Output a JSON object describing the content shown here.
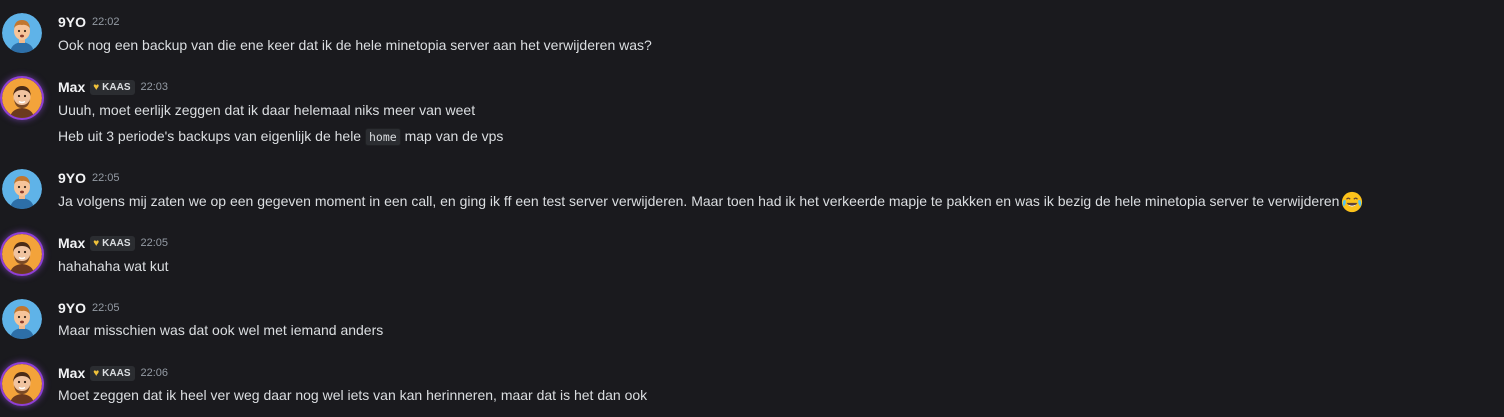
{
  "messages": [
    {
      "author": "9YO",
      "time": "22:02",
      "lines": [
        "Ook nog een backup van die ene keer dat ik de hele minetopia server aan het verwijderen was?"
      ]
    },
    {
      "author": "Max",
      "tag": "KAAS",
      "time": "22:03",
      "line1": "Uuuh, moet eerlijk zeggen dat ik daar helemaal niks meer van weet",
      "line2_before": "Heb uit 3 periode's backups van eigenlijk de hele",
      "line2_code": "home",
      "line2_after": "map van de vps"
    },
    {
      "author": "9YO",
      "time": "22:05",
      "lines": [
        "Ja volgens mij zaten we op een gegeven moment in een call, en ging ik ff een test server verwijderen. Maar toen had ik het verkeerde mapje te pakken en was ik bezig de hele minetopia server te verwijderen"
      ],
      "emoji": "joy-emoji"
    },
    {
      "author": "Max",
      "tag": "KAAS",
      "time": "22:05",
      "lines": [
        "hahahaha wat kut"
      ]
    },
    {
      "author": "9YO",
      "time": "22:05",
      "lines": [
        "Maar misschien was dat ook wel met iemand anders"
      ]
    },
    {
      "author": "Max",
      "tag": "KAAS",
      "time": "22:06",
      "lines": [
        "Moet zeggen dat ik heel ver weg daar nog wel iets van kan herinneren, maar dat is het dan ook"
      ]
    }
  ],
  "colors": {
    "background": "#1a1a1e",
    "text": "#dbdee1",
    "username": "#f2f3f5",
    "timestamp": "#949ba4",
    "avatar_ring": "#8f3fd6",
    "tag_heart": "#f0c23a"
  },
  "icons": {
    "avatar_9yo": "avatar-9yo-icon",
    "avatar_max": "avatar-max-icon",
    "tag": "heart-icon"
  }
}
